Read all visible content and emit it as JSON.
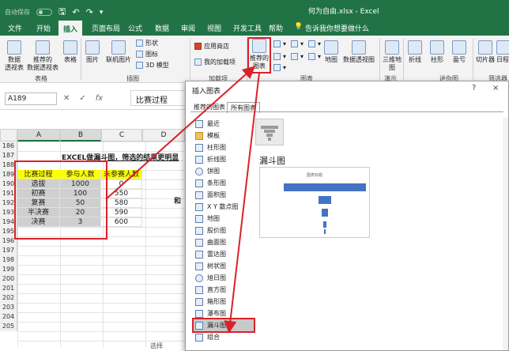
{
  "titlebar": {
    "autosave": "自动保存",
    "autosave_state": "关",
    "filename": "何为自由.xlsx - Excel"
  },
  "tabs": [
    "文件",
    "开始",
    "插入",
    "页面布局",
    "公式",
    "数据",
    "审阅",
    "视图",
    "开发工具",
    "帮助"
  ],
  "active_tab": "插入",
  "tell_me": "告诉我你想要做什么",
  "ribbon": {
    "pivot": "数据\n透视表",
    "rec_pivot": "推荐的\n数据透视表",
    "table": "表格",
    "group_tables": "表格",
    "picture": "图片",
    "online_picture": "联机图片",
    "shapes": "形状",
    "icons": "图标",
    "model3d": "3D 模型",
    "group_illustrations": "插图",
    "store": "应用商店",
    "my_addins": "我的加载项",
    "group_addins": "加载项",
    "rec_charts": "推荐的\n图表",
    "maps": "地图",
    "pivot_chart": "数据透视图",
    "group_charts": "图表",
    "map3d": "三维地\n图",
    "group_tours": "演示",
    "line": "折线",
    "column": "柱形",
    "winloss": "盈亏",
    "group_sparklines": "迷你图",
    "slicer": "切片器",
    "timeline": "日程",
    "group_filters": "筛选器"
  },
  "formula_bar": {
    "namebox": "A189",
    "content": "比赛过程"
  },
  "sheet": {
    "columns": [
      "A",
      "B",
      "C",
      "D"
    ],
    "rows": [
      "186",
      "187",
      "188",
      "189",
      "190",
      "191",
      "192",
      "193",
      "194",
      "195",
      "196",
      "197",
      "198",
      "199",
      "200",
      "201",
      "202",
      "203",
      "204",
      "205"
    ],
    "heading": "EXCEL做漏斗图，筛选的结果更明显",
    "table_headers": [
      "比赛过程",
      "参与人数",
      "未参赛人数"
    ],
    "table_rows": [
      [
        "选拔",
        "1000",
        "0"
      ],
      [
        "初赛",
        "100",
        "550"
      ],
      [
        "复赛",
        "50",
        "580"
      ],
      [
        "半决赛",
        "20",
        "590"
      ],
      [
        "决赛",
        "3",
        "600"
      ]
    ],
    "side_text": "和",
    "bottom_tab": "选择"
  },
  "dialog": {
    "title": "插入图表",
    "help": "?",
    "close": "×",
    "tab_recommended": "推荐的图表",
    "tab_all": "所有图表",
    "categories": [
      "最近",
      "模板",
      "柱形图",
      "折线图",
      "饼图",
      "条形图",
      "面积图",
      "X Y 散点图",
      "地图",
      "股价图",
      "曲面图",
      "雷达图",
      "树状图",
      "旭日图",
      "直方图",
      "箱形图",
      "瀑布图",
      "漏斗图",
      "组合"
    ],
    "selected": "漏斗图",
    "chart_name": "漏斗图",
    "preview_title": "图表标题"
  },
  "colors": {
    "excel_green": "#217346",
    "highlight": "#d8222a",
    "header_fill": "#ffff00"
  }
}
